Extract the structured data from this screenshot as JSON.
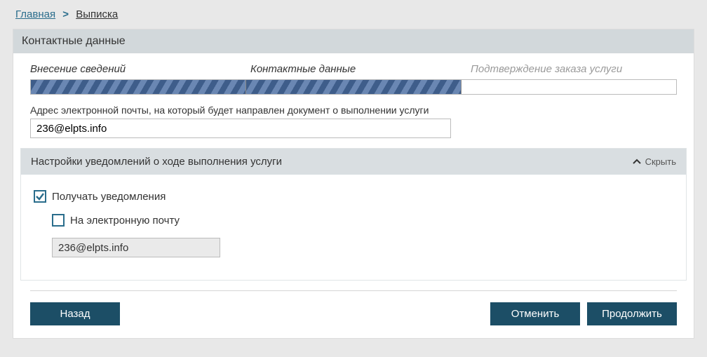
{
  "breadcrumb": {
    "home": "Главная",
    "current": "Выписка"
  },
  "panel": {
    "title": "Контактные данные"
  },
  "steps": {
    "s1": "Внесение сведений",
    "s2": "Контактные данные",
    "s3": "Подтверждение заказа услуги"
  },
  "email_field": {
    "label": "Адрес электронной почты, на который будет направлен документ о выполнении услуги",
    "value": "236@elpts.info"
  },
  "notifications": {
    "title": "Настройки уведомлений о ходе выполнения услуги",
    "hide": "Скрыть",
    "receive": "Получать уведомления",
    "by_email": "На электронную почту",
    "email_value": "236@elpts.info"
  },
  "buttons": {
    "back": "Назад",
    "cancel": "Отменить",
    "continue": "Продолжить"
  }
}
